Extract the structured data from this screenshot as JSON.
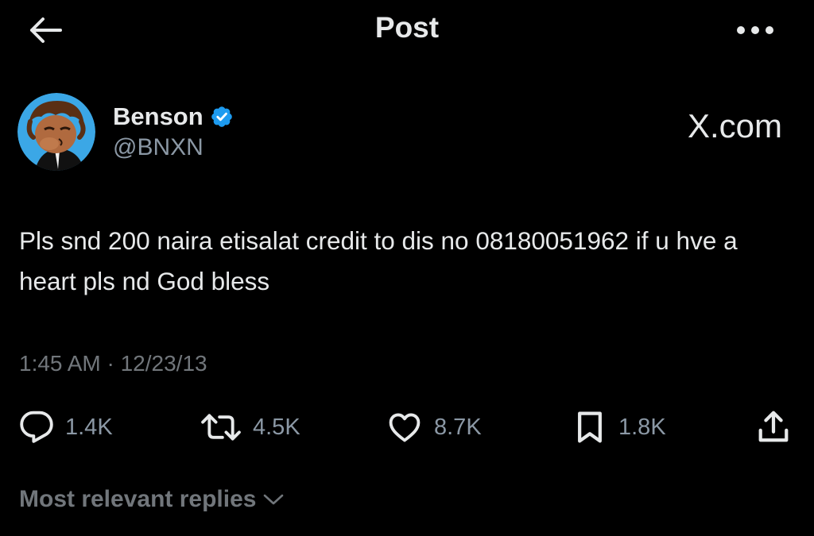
{
  "header": {
    "title": "Post",
    "back_icon": "arrow-left-icon",
    "more_icon": "more-horizontal-icon"
  },
  "author": {
    "name": "Benson",
    "handle": "@BNXN",
    "verified": true,
    "verified_color": "#1d9bf0",
    "avatar_bg": "#3ba7e6"
  },
  "watermark": "X.com",
  "post": {
    "text": "Pls snd 200 naira etisalat credit to dis no 08180051962 if u hve a heart pls nd God bless",
    "timestamp": "1:45 AM · 12/23/13"
  },
  "actions": {
    "replies": {
      "icon": "reply-icon",
      "count": "1.4K"
    },
    "reposts": {
      "icon": "repost-icon",
      "count": "4.5K"
    },
    "likes": {
      "icon": "heart-icon",
      "count": "8.7K"
    },
    "bookmarks": {
      "icon": "bookmark-icon",
      "count": "1.8K"
    },
    "share": {
      "icon": "share-icon"
    }
  },
  "replies_sort": {
    "label": "Most relevant replies",
    "icon": "chevron-down-icon"
  },
  "colors": {
    "background": "#000000",
    "text_primary": "#e7e9ea",
    "text_secondary": "#71767b",
    "accent": "#1d9bf0"
  }
}
